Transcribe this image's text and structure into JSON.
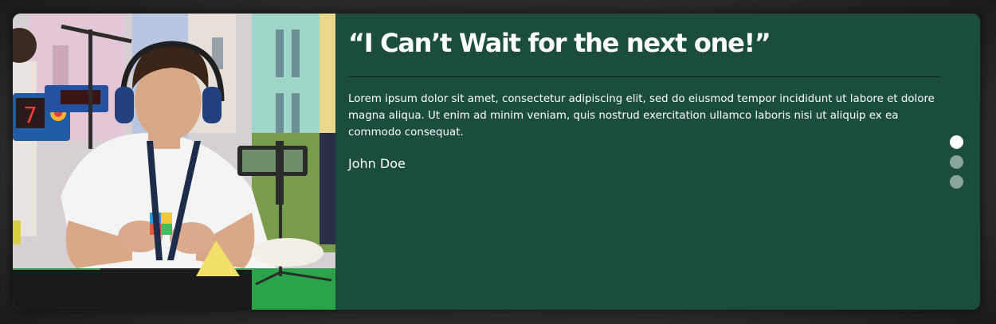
{
  "testimonial": {
    "quote": "“I Can’t Wait for the next one!”",
    "body": "Lorem ipsum dolor sit amet, consectetur adipiscing elit, sed do eiusmod tempor incididunt ut labore et dolore magna aliqua. Ut enim ad minim veniam, quis nostrud exercitation ullamco laboris nisi ut aliquip ex ea commodo consequat.",
    "author": "John Doe"
  },
  "photo": {
    "timer_display": "7"
  },
  "pagination": {
    "count": 3,
    "active_index": 0
  },
  "colors": {
    "card_background": "#1b4d3e",
    "dot_active": "#ffffff",
    "dot_inactive": "#8aa59c"
  }
}
